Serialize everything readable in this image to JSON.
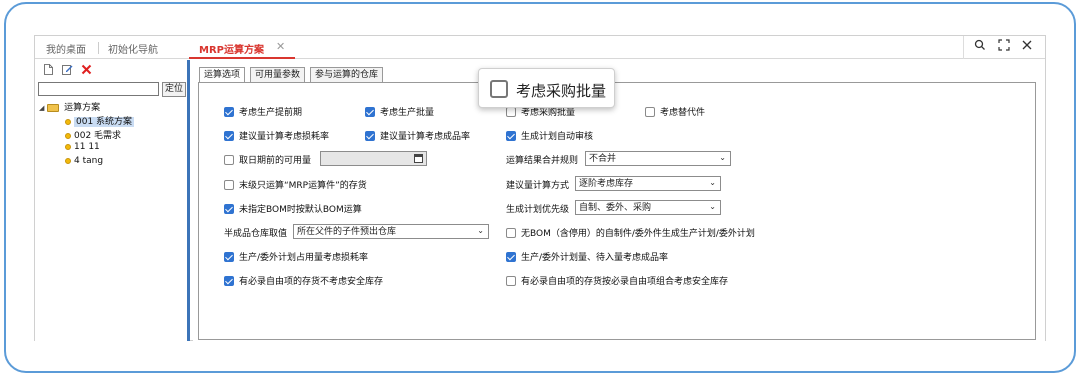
{
  "tabs": {
    "desktop": "我的桌面",
    "init_nav": "初始化导航",
    "active": "MRP运算方案",
    "close_glyph": "✕"
  },
  "window": {
    "search_icon": "search-icon",
    "fullscreen_icon": "fullscreen-icon",
    "close_icon": "close-icon"
  },
  "left": {
    "search_value": "",
    "locate_label": "定位",
    "tree": {
      "root": "运算方案",
      "items": [
        "001 系统方案",
        "002 毛需求",
        "11 11",
        "4 tang"
      ]
    }
  },
  "subtabs": [
    "运算选项",
    "可用量参数",
    "参与运算的仓库"
  ],
  "options": {
    "c1": "考虑生产提前期",
    "c2": "考虑生产批量",
    "c3": "考虑采购批量",
    "c4": "考虑替代件",
    "c5": "建议量计算考虑损耗率",
    "c6": "建议量计算考虑成品率",
    "c7": "生成计划自动审核",
    "c8": "取日期前的可用量",
    "merge_label": "运算结果合并规则",
    "merge_value": "不合并",
    "c9": "末级只运算“MRP运算件”的存货",
    "calc_label": "建议量计算方式",
    "calc_value": "逐阶考虑库存",
    "c10": "未指定BOM时按默认BOM运算",
    "priority_label": "生成计划优先级",
    "priority_value": "自制、委外、采购",
    "semi_label": "半成品仓库取值",
    "semi_value": "所在父件的子件预出仓库",
    "c11": "无BOM（含停用）的自制件/委外件生成生产计划/委外计划",
    "c12": "生产/委外计划占用量考虑损耗率",
    "c13": "生产/委外计划量、待入量考虑成品率",
    "c14": "有必录自由项的存货不考虑安全库存",
    "c15": "有必录自由项的存货按必录自由项组合考虑安全库存"
  },
  "callout": {
    "label": "考虑采购批量"
  },
  "colors": {
    "accent": "#d9362f",
    "checkbox": "#2f73d1",
    "frame": "#5b9bd8",
    "panel_divider": "#3c74b8"
  }
}
